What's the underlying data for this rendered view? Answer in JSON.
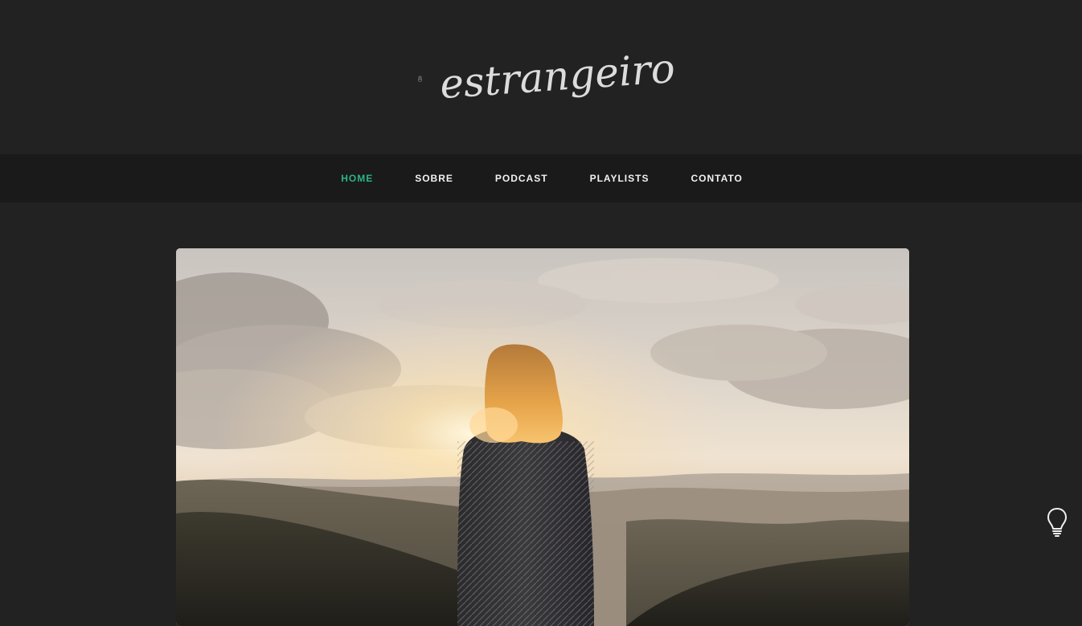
{
  "site": {
    "logo_text": "estrangeiro",
    "logo_icon": "backpack-icon"
  },
  "nav": {
    "items": [
      {
        "label": "HOME",
        "active": true
      },
      {
        "label": "SOBRE",
        "active": false
      },
      {
        "label": "PODCAST",
        "active": false
      },
      {
        "label": "PLAYLISTS",
        "active": false
      },
      {
        "label": "CONTATO",
        "active": false
      }
    ]
  },
  "hero": {
    "image": "woman-watching-sunset-over-mountains"
  },
  "theme_toggle": {
    "icon": "lightbulb-icon"
  },
  "colors": {
    "background": "#222222",
    "nav_background": "#1a1a1a",
    "accent": "#2db388",
    "nav_text": "#f2f2f2",
    "logo": "#dcdcdc"
  }
}
